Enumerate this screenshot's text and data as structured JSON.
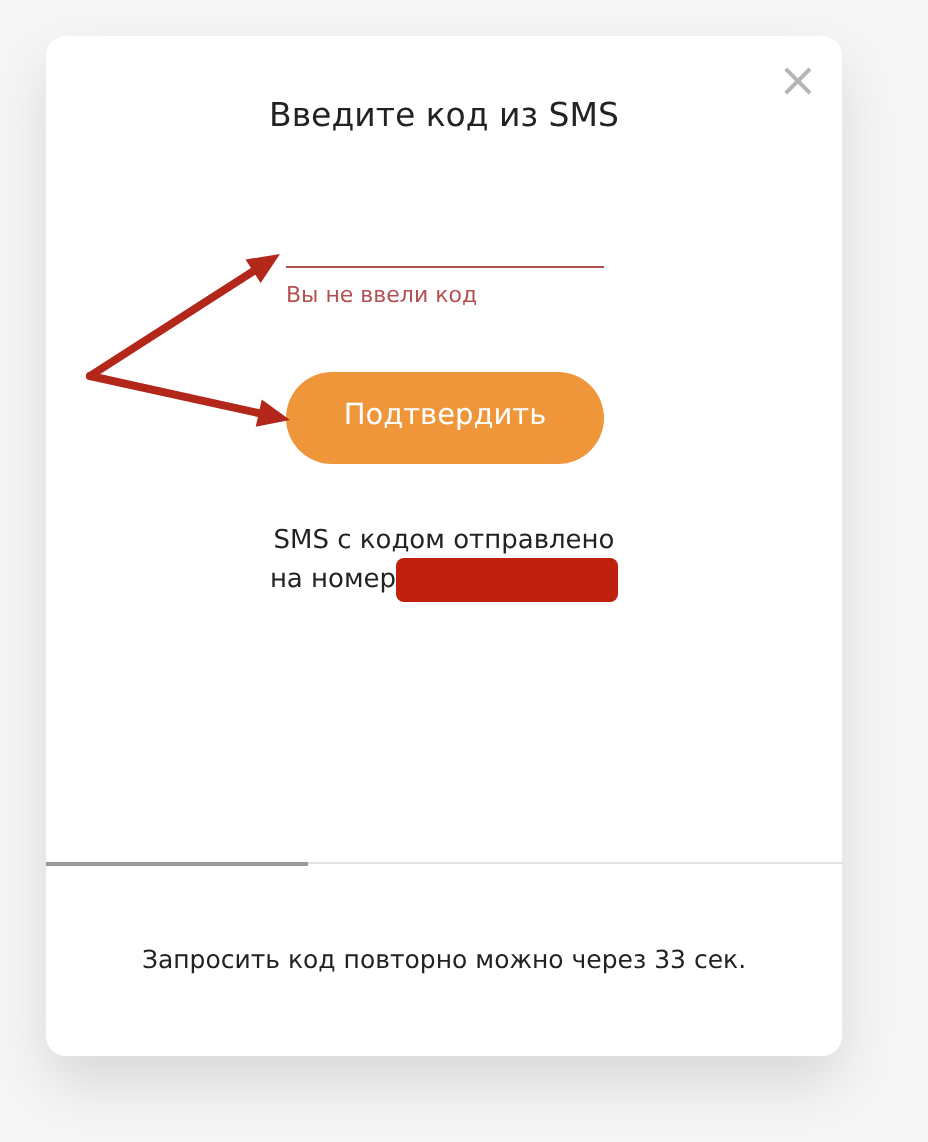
{
  "dialog": {
    "title": "Введите код из SMS",
    "close": "×",
    "code_field": {
      "error": "Вы не ввели код"
    },
    "confirm_button": "Подтвердить",
    "sms_note": [
      "SMS с кодом отправлено",
      "на номер"
    ],
    "phone_redacted": true,
    "resend_timer": {
      "level": 0.33,
      "text": "Запросить код повторно можно через 33 сек."
    }
  },
  "annotations": [
    {
      "kind": "arrow"
    },
    {
      "kind": "arrow"
    }
  ]
}
